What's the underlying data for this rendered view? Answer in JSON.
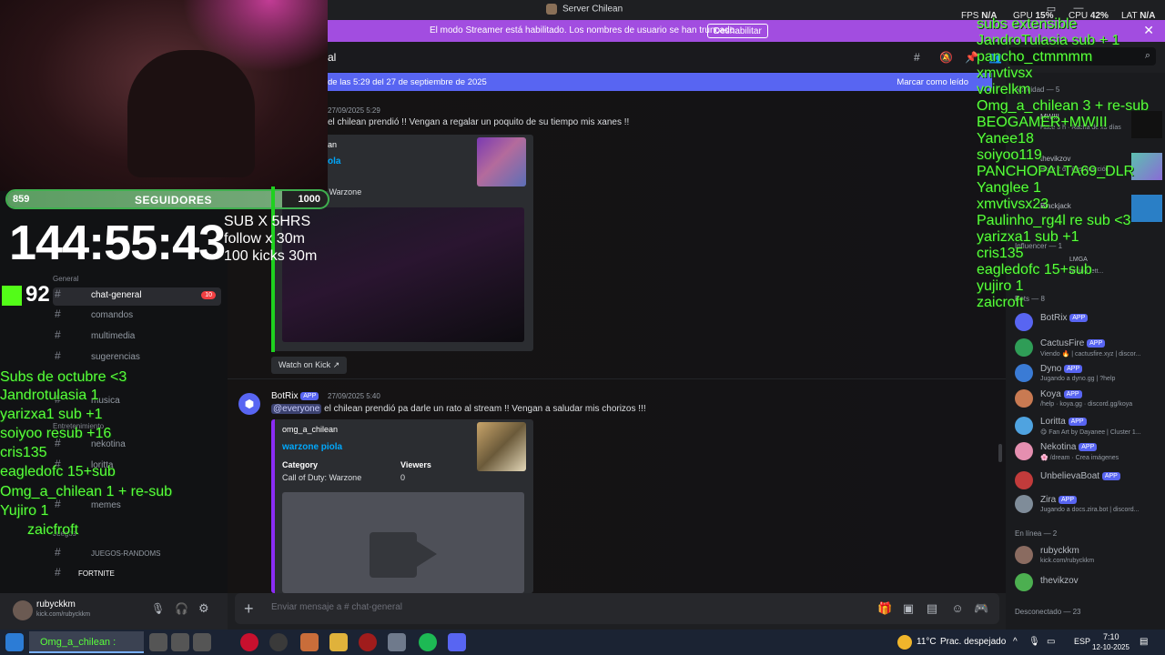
{
  "window": {
    "title": "Server Chilean",
    "perf": {
      "fps_label": "FPS",
      "fps": "N/A",
      "gpu_label": "GPU",
      "gpu": "15%",
      "cpu_label": "CPU",
      "cpu": "42%",
      "lat_label": "LAT",
      "lat": "N/A"
    }
  },
  "banner": {
    "message": "El modo Streamer está habilitado. Los nombres de usuario se han truncado.",
    "button": "Deshabilitar"
  },
  "header": {
    "channel": "al"
  },
  "new_messages": {
    "text": "de las 5:29 del 27 de septiembre de 2025",
    "mark_read": "Marcar como leído"
  },
  "chat": {
    "msg1": {
      "timestamp": "27/09/2025 5:29",
      "text": "el chilean prendió !! Vengan a regalar un poquito de su tiempo mis xanes !!",
      "embed_author": "an",
      "embed_title": "ola",
      "embed_category": "Call of Duty: Warzone",
      "watch": "Watch on Kick"
    },
    "msg2": {
      "author": "BotRix",
      "badge": "APP",
      "timestamp": "27/09/2025 5:40",
      "mention": "@everyone",
      "text": "el chilean prendió pa darle un rato al stream !! Vengan a saludar mis chorizos !!!",
      "embed_author": "omg_a_chilean",
      "embed_title": "warzone piola",
      "field1_name": "Category",
      "field1_value": "Call of Duty: Warzone",
      "field2_name": "Viewers",
      "field2_value": "0"
    }
  },
  "composer": {
    "placeholder": "Enviar mensaje a #",
    "channel": "chat-general"
  },
  "channels": {
    "category_general": "General",
    "items": [
      {
        "name": "chat-general",
        "badge": "10"
      },
      {
        "name": "comandos"
      },
      {
        "name": "multimedia"
      },
      {
        "name": "sugerencias"
      },
      {
        "name": "musica"
      },
      {
        "name": "nekotina"
      },
      {
        "name": "loritta"
      },
      {
        "name": "memes"
      }
    ],
    "category_ent": "Entretenimiento",
    "category_games": "Juegos",
    "games": [
      "JUEGOS-RANDOMS",
      "FORTNITE"
    ]
  },
  "user": {
    "name": "rubyckkm",
    "status": "kick.com/rubyckkm"
  },
  "members": {
    "activity_section": "Actividad — 5",
    "activities": [
      {
        "name": "MWIII",
        "status": "Hace 3 h · Racha de x3 días"
      },
      {
        "name": "thevikzov",
        "status": "Hace 2 d · Resurrección"
      },
      {
        "name": "Blackjack",
        "status": ""
      },
      {
        "name": "LMGA",
        "status": "writing lett..."
      }
    ],
    "influencers_section": "Influencer — 1",
    "bots_section": "Bots — 8",
    "bots": [
      {
        "name": "BotRix",
        "status": "",
        "color": "#5865f2"
      },
      {
        "name": "CactusFire",
        "status": "Viendo 🔥 | cactusfire.xyz | discor...",
        "color": "#2f9d57"
      },
      {
        "name": "Dyno",
        "status": "Jugando a dyno.gg | ?help",
        "color": "#3a7bd5"
      },
      {
        "name": "Koya",
        "status": "/help · koya.gg · discord.gg/koya",
        "color": "#c97a52"
      },
      {
        "name": "Loritta",
        "status": "😋 Fan Art by Dayanee | Cluster 1...",
        "color": "#4fa3e0"
      },
      {
        "name": "Nekotina",
        "status": "🌸 /dream · Crea imágenes",
        "color": "#e58fb0"
      },
      {
        "name": "UnbelievaBoat",
        "status": "",
        "color": "#c23b3b"
      },
      {
        "name": "Zira",
        "status": "Jugando a docs.zira.bot | discord...",
        "color": "#7f8c99"
      }
    ],
    "online_section": "En línea — 2",
    "online": [
      {
        "name": "rubyckkm",
        "status": "kick.com/rubyckkm",
        "color": "#8a6b60"
      },
      {
        "name": "thevikzov",
        "status": "",
        "color": "#4caf50"
      }
    ],
    "offline_section": "Desconectado — 23"
  },
  "overlay": {
    "followers_current": "859",
    "followers_label": "SEGUIDORES",
    "followers_goal": "1000",
    "followers_progress": 0.859,
    "timer": "144:55:43",
    "rules": [
      "SUB X 5HRS",
      "follow x 30m",
      "100 kicks 30m"
    ],
    "kick_count": "92",
    "left_feed": [
      "Subs de octubre <3",
      "Jandrotulasia 1",
      "yarizxa1 sub +1",
      "soiyoo resub +16",
      "cris135",
      "eagledofc 15+sub",
      "Omg_a_chilean 1 + re-sub",
      "Yujiro 1",
      "zaicfroft"
    ],
    "right_feed": [
      "subs extensible",
      "JandroTulasia sub + 1",
      "pancho_ctmmmm",
      "xmvtivsx",
      "voirelkm",
      "Omg_a_chilean 3 + re-sub",
      "BEOGAMER+MWIII",
      "Yanee18",
      "soiyoo119",
      "PANCHOPALTA69_DLR",
      "Yanglee 1",
      "xmvtivsx23",
      "Paulinho_rg4l re sub <3",
      "yarizxa1 sub +1",
      "cris135",
      "eagledofc 15+sub",
      "yujiro 1",
      "zaicroft"
    ]
  },
  "taskbar": {
    "active_title": "Omg_a_chilean :",
    "weather_temp": "11°C",
    "weather_desc": "Prac. despejado",
    "lang": "ESP",
    "time": "7:10",
    "date": "12-10-2025"
  }
}
